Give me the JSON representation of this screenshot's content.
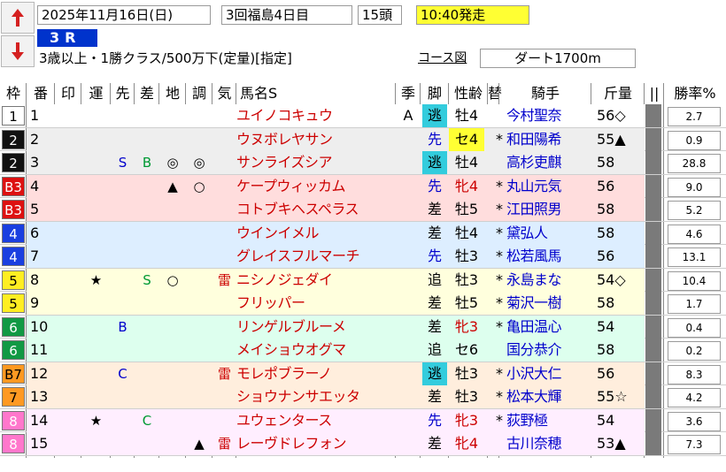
{
  "header": {
    "date": "2025年11月16日(日)",
    "kai": "3回福島4日目",
    "heads": "15頭",
    "post_time": "10:40発走",
    "race_no": "3R",
    "conditions": "3歳以上・1勝クラス/500万下(定量)[指定]",
    "course_link": "コース図",
    "course": "ダート1700m"
  },
  "columns": [
    "枠",
    "番",
    "印",
    "運",
    "先",
    "差",
    "地",
    "調",
    "気",
    "馬名S",
    "季",
    "脚",
    "性齢",
    "替",
    "騎手",
    "斤量",
    "||",
    "勝率%"
  ],
  "colors": {
    "name_red": "#cc0000",
    "jockey_blue": "#0000cc",
    "nige_cyan": "#33ccdd",
    "yellow": "#ffff33",
    "race_blue": "#0033cc"
  },
  "rows": [
    {
      "waku": "1",
      "num": "1",
      "un": "",
      "saki": "",
      "sa": "",
      "chi": "",
      "cho": "",
      "ki": "",
      "name": "ユイノコキュウ",
      "season": "A",
      "kyaku": "逃",
      "sexage": "牡4",
      "kae": "",
      "jockey": "今村聖奈",
      "kin": "56◇",
      "odds": "2.7"
    },
    {
      "waku": "2",
      "num": "2",
      "un": "",
      "saki": "",
      "sa": "",
      "chi": "",
      "cho": "",
      "ki": "",
      "name": "ウヌボレヤサン",
      "season": "",
      "kyaku": "先",
      "sexage": "セ4",
      "kae": "*",
      "jockey": "和田陽希",
      "kin": "55▲",
      "odds": "0.9"
    },
    {
      "waku": "2",
      "num": "3",
      "un": "",
      "saki": "S",
      "sa": "B",
      "chi": "◎",
      "cho": "◎",
      "ki": "",
      "name": "サンライズシア",
      "season": "",
      "kyaku": "逃",
      "sexage": "牡4",
      "kae": "",
      "jockey": "高杉吏麒",
      "kin": "58",
      "odds": "28.8"
    },
    {
      "waku": "B3",
      "num": "4",
      "un": "",
      "saki": "",
      "sa": "",
      "chi": "▲",
      "cho": "○",
      "ki": "",
      "name": "ケープウィッカム",
      "season": "",
      "kyaku": "先",
      "sexage": "牝4",
      "kae": "*",
      "jockey": "丸山元気",
      "kin": "56",
      "odds": "9.0"
    },
    {
      "waku": "B3",
      "num": "5",
      "un": "",
      "saki": "",
      "sa": "",
      "chi": "",
      "cho": "",
      "ki": "",
      "name": "コトブキヘスペラス",
      "season": "",
      "kyaku": "差",
      "sexage": "牡5",
      "kae": "*",
      "jockey": "江田照男",
      "kin": "58",
      "odds": "5.2"
    },
    {
      "waku": "4",
      "num": "6",
      "un": "",
      "saki": "",
      "sa": "",
      "chi": "",
      "cho": "",
      "ki": "",
      "name": "ウインイメル",
      "season": "",
      "kyaku": "差",
      "sexage": "牡4",
      "kae": "*",
      "jockey": "黛弘人",
      "kin": "58",
      "odds": "4.6"
    },
    {
      "waku": "4",
      "num": "7",
      "un": "",
      "saki": "",
      "sa": "",
      "chi": "",
      "cho": "",
      "ki": "",
      "name": "グレイスフルマーチ",
      "season": "",
      "kyaku": "先",
      "sexage": "牡3",
      "kae": "*",
      "jockey": "松若風馬",
      "kin": "56",
      "odds": "13.1"
    },
    {
      "waku": "5",
      "num": "8",
      "un": "★",
      "saki": "",
      "sa": "S",
      "chi": "○",
      "cho": "",
      "ki": "雷",
      "name": "ニシノジェダイ",
      "season": "",
      "kyaku": "追",
      "sexage": "牡3",
      "kae": "*",
      "jockey": "永島まな",
      "kin": "54◇",
      "odds": "10.4"
    },
    {
      "waku": "5",
      "num": "9",
      "un": "",
      "saki": "",
      "sa": "",
      "chi": "",
      "cho": "",
      "ki": "",
      "name": "フリッパー",
      "season": "",
      "kyaku": "差",
      "sexage": "牡5",
      "kae": "*",
      "jockey": "菊沢一樹",
      "kin": "58",
      "odds": "1.7"
    },
    {
      "waku": "6",
      "num": "10",
      "un": "",
      "saki": "B",
      "sa": "",
      "chi": "",
      "cho": "",
      "ki": "",
      "name": "リンゲルブルーメ",
      "season": "",
      "kyaku": "差",
      "sexage": "牝3",
      "kae": "*",
      "jockey": "亀田温心",
      "kin": "54",
      "odds": "0.4"
    },
    {
      "waku": "6",
      "num": "11",
      "un": "",
      "saki": "",
      "sa": "",
      "chi": "",
      "cho": "",
      "ki": "",
      "name": "メイショウオグマ",
      "season": "",
      "kyaku": "追",
      "sexage": "セ6",
      "kae": "",
      "jockey": "国分恭介",
      "kin": "58",
      "odds": "0.2"
    },
    {
      "waku": "B7",
      "num": "12",
      "un": "",
      "saki": "C",
      "sa": "",
      "chi": "",
      "cho": "",
      "ki": "雷",
      "name": "モレポブラーノ",
      "season": "",
      "kyaku": "逃",
      "sexage": "牡3",
      "kae": "*",
      "jockey": "小沢大仁",
      "kin": "56",
      "odds": "8.3"
    },
    {
      "waku": "7",
      "num": "13",
      "un": "",
      "saki": "",
      "sa": "",
      "chi": "",
      "cho": "",
      "ki": "",
      "name": "ショウナンサエッタ",
      "season": "",
      "kyaku": "差",
      "sexage": "牡3",
      "kae": "*",
      "jockey": "松本大輝",
      "kin": "55☆",
      "odds": "4.2"
    },
    {
      "waku": "8",
      "num": "14",
      "un": "★",
      "saki": "",
      "sa": "C",
      "chi": "",
      "cho": "",
      "ki": "",
      "name": "ユウェンタース",
      "season": "",
      "kyaku": "先",
      "sexage": "牝3",
      "kae": "*",
      "jockey": "荻野極",
      "kin": "54",
      "odds": "3.6"
    },
    {
      "waku": "8",
      "num": "15",
      "un": "",
      "saki": "",
      "sa": "",
      "chi": "",
      "cho": "▲",
      "ki": "雷",
      "name": "レーヴドレフォン",
      "season": "",
      "kyaku": "差",
      "sexage": "牝4",
      "kae": "",
      "jockey": "古川奈穂",
      "kin": "53▲",
      "odds": "7.3"
    }
  ]
}
